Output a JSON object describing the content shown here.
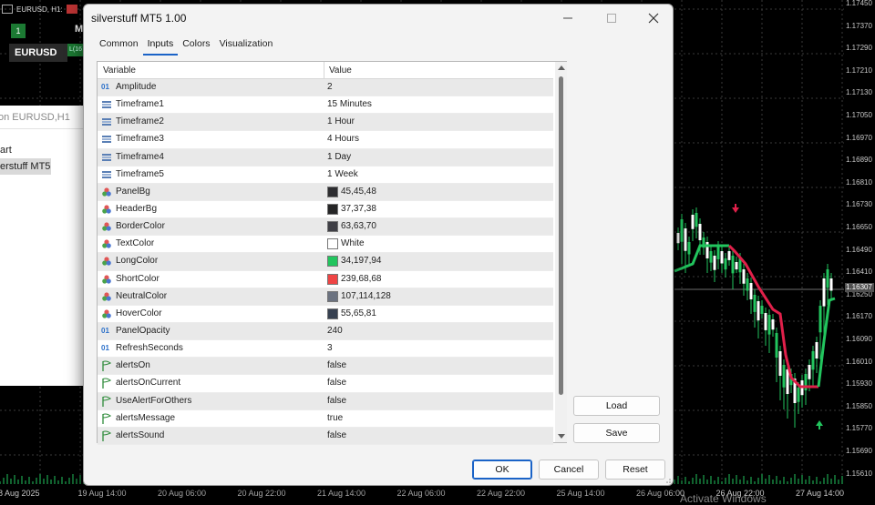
{
  "chart_header": {
    "tab_title": "EURUSD, H1:"
  },
  "trade_panel": {
    "number": "1",
    "m_label": "M",
    "symbol": "EURUSD",
    "lot_label": "L(16"
  },
  "navigator": {
    "header": "on EURUSD,H1",
    "items": [
      {
        "label": "art"
      },
      {
        "label": "erstuff MT5"
      }
    ]
  },
  "price_scale": {
    "labels": [
      "1.17450",
      "1.17370",
      "1.17290",
      "1.17210",
      "1.17130",
      "1.17050",
      "1.16970",
      "1.16890",
      "1.16810",
      "1.16730",
      "1.16650",
      "1.16490",
      "1.16410",
      "1.16250",
      "1.16170",
      "1.16090",
      "1.16010",
      "1.15930",
      "1.15850",
      "1.15770",
      "1.15690",
      "1.15610"
    ],
    "current": "1.16307"
  },
  "time_axis": {
    "labels": [
      "8 Aug 2025",
      "19 Aug 14:00",
      "20 Aug 06:00",
      "20 Aug 22:00",
      "21 Aug 14:00",
      "22 Aug 06:00",
      "22 Aug 22:00",
      "25 Aug 14:00",
      "26 Aug 06:00",
      "26 Aug 22:00",
      "27 Aug 14:00"
    ]
  },
  "watermark": "Activate Windows",
  "dialog": {
    "title": "silverstuff MT5 1.00",
    "tabs": [
      {
        "label": "Common",
        "active": false
      },
      {
        "label": "Inputs",
        "active": true
      },
      {
        "label": "Colors",
        "active": false
      },
      {
        "label": "Visualization",
        "active": false
      }
    ],
    "grid": {
      "col_variable": "Variable",
      "col_value": "Value",
      "rows": [
        {
          "icon": "int-icon",
          "name": "Amplitude",
          "value": "2"
        },
        {
          "icon": "enum-icon",
          "name": "Timeframe1",
          "value": "15 Minutes"
        },
        {
          "icon": "enum-icon",
          "name": "Timeframe2",
          "value": "1 Hour"
        },
        {
          "icon": "enum-icon",
          "name": "Timeframe3",
          "value": "4 Hours"
        },
        {
          "icon": "enum-icon",
          "name": "Timeframe4",
          "value": "1 Day"
        },
        {
          "icon": "enum-icon",
          "name": "Timeframe5",
          "value": "1 Week"
        },
        {
          "icon": "color-icon",
          "name": "PanelBg",
          "value": "45,45,48",
          "swatch": "#2d2d30"
        },
        {
          "icon": "color-icon",
          "name": "HeaderBg",
          "value": "37,37,38",
          "swatch": "#252526"
        },
        {
          "icon": "color-icon",
          "name": "BorderColor",
          "value": "63,63,70",
          "swatch": "#3f3f46"
        },
        {
          "icon": "color-icon",
          "name": "TextColor",
          "value": "White",
          "swatch": "#ffffff"
        },
        {
          "icon": "color-icon",
          "name": "LongColor",
          "value": "34,197,94",
          "swatch": "#22c55e"
        },
        {
          "icon": "color-icon",
          "name": "ShortColor",
          "value": "239,68,68",
          "swatch": "#ef4444"
        },
        {
          "icon": "color-icon",
          "name": "NeutralColor",
          "value": "107,114,128",
          "swatch": "#6b7280"
        },
        {
          "icon": "color-icon",
          "name": "HoverColor",
          "value": "55,65,81",
          "swatch": "#374151"
        },
        {
          "icon": "int-icon",
          "name": "PanelOpacity",
          "value": "240"
        },
        {
          "icon": "int-icon",
          "name": "RefreshSeconds",
          "value": "3"
        },
        {
          "icon": "bool-icon",
          "name": "alertsOn",
          "value": "false"
        },
        {
          "icon": "bool-icon",
          "name": "alertsOnCurrent",
          "value": "false"
        },
        {
          "icon": "bool-icon",
          "name": "UseAlertForOthers",
          "value": "false"
        },
        {
          "icon": "bool-icon",
          "name": "alertsMessage",
          "value": "true"
        },
        {
          "icon": "bool-icon",
          "name": "alertsSound",
          "value": "false"
        }
      ]
    },
    "side_buttons": {
      "load": "Load",
      "save": "Save"
    },
    "footer_buttons": {
      "ok": "OK",
      "cancel": "Cancel",
      "reset": "Reset"
    }
  },
  "colors": {
    "chart_bg": "#000000",
    "candle_green": "#22c55e",
    "trend_red": "#e0204a",
    "accent_blue": "#1a63c7"
  }
}
